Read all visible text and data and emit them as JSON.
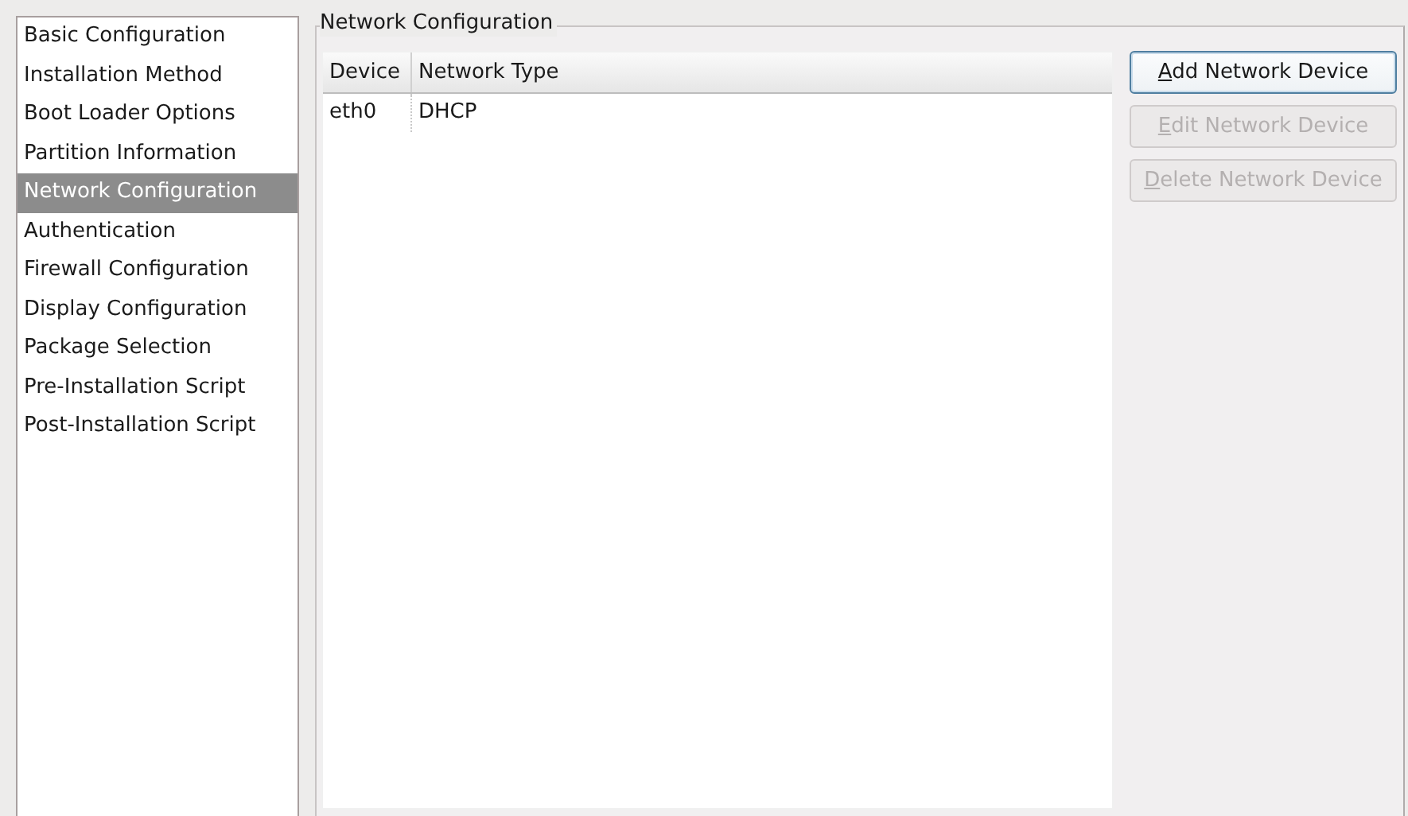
{
  "sidebar": {
    "items": [
      {
        "label": "Basic Configuration",
        "selected": false
      },
      {
        "label": "Installation Method",
        "selected": false
      },
      {
        "label": "Boot Loader Options",
        "selected": false
      },
      {
        "label": "Partition Information",
        "selected": false
      },
      {
        "label": "Network Configuration",
        "selected": true
      },
      {
        "label": "Authentication",
        "selected": false
      },
      {
        "label": "Firewall Configuration",
        "selected": false
      },
      {
        "label": "Display Configuration",
        "selected": false
      },
      {
        "label": "Package Selection",
        "selected": false
      },
      {
        "label": "Pre-Installation Script",
        "selected": false
      },
      {
        "label": "Post-Installation Script",
        "selected": false
      }
    ]
  },
  "panel": {
    "title": "Network Configuration",
    "table": {
      "columns": [
        "Device",
        "Network Type"
      ],
      "rows": [
        [
          "eth0",
          "DHCP"
        ]
      ]
    },
    "buttons": [
      {
        "label": "Add Network Device",
        "disabled": false,
        "focused": true,
        "mnemonic_first": true
      },
      {
        "label": "Edit Network Device",
        "disabled": true,
        "focused": false,
        "mnemonic_first": true
      },
      {
        "label": "Delete Network Device",
        "disabled": true,
        "focused": false,
        "mnemonic_first": true
      }
    ]
  }
}
